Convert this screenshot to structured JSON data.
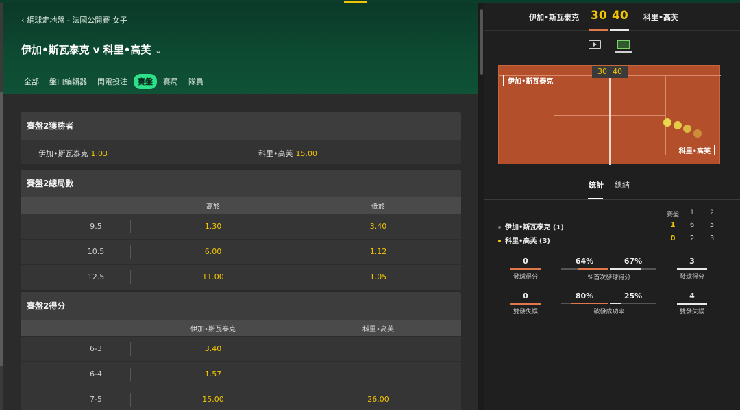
{
  "header": {
    "breadcrumb": "網球走地盤 - 法國公開賽 女子",
    "title": "伊加•斯瓦泰克 v 科里•高芙",
    "tabs": [
      "全部",
      "盤口編輯器",
      "閃電投注",
      "賽盤",
      "賽局",
      "隊員"
    ],
    "active_tab": "賽盤"
  },
  "markets": {
    "winner": {
      "title": "賽盤2獲勝者",
      "p1": "伊加•斯瓦泰克",
      "p1_odds": "1.03",
      "p2": "科里•高芙",
      "p2_odds": "15.00"
    },
    "total_games": {
      "title": "賽盤2總局數",
      "col_over": "高於",
      "col_under": "低於",
      "rows": [
        {
          "line": "9.5",
          "over": "1.30",
          "under": "3.40"
        },
        {
          "line": "10.5",
          "over": "6.00",
          "under": "1.12"
        },
        {
          "line": "12.5",
          "over": "11.00",
          "under": "1.05"
        }
      ]
    },
    "correct_score": {
      "title": "賽盤2得分",
      "col_p1": "伊加•斯瓦泰克",
      "col_p2": "科里•高芙",
      "rows": [
        {
          "score": "6-3",
          "p1": "3.40",
          "p2": ""
        },
        {
          "score": "6-4",
          "p1": "1.57",
          "p2": ""
        },
        {
          "score": "7-5",
          "p1": "15.00",
          "p2": "26.00"
        }
      ]
    }
  },
  "scoreboard": {
    "p1": "伊加•斯瓦泰克",
    "p1_points": "30",
    "p2": "科里•高芙",
    "p2_points": "40",
    "court_p1": "伊加•斯瓦泰克",
    "court_p2": "科里•高芙",
    "icons": [
      "video-icon",
      "court-icon"
    ]
  },
  "stats": {
    "tabs": [
      "統計",
      "總結"
    ],
    "sets_label": "賽盤",
    "set_numbers": [
      "1",
      "2"
    ],
    "p1": {
      "name": "伊加•斯瓦泰克 (1)",
      "current": "1",
      "sets": [
        "6",
        "5"
      ]
    },
    "p2": {
      "name": "科里•高芙 (3)",
      "current": "0",
      "sets": [
        "2",
        "3"
      ]
    },
    "aces": {
      "p1": "0",
      "p2": "3",
      "label": "發球得分"
    },
    "first_serve": {
      "p1": "64%",
      "p2": "67%",
      "p1_value": 0.64,
      "p2_value": 0.67,
      "label": "%首次發球得分"
    },
    "double_faults": {
      "p1": "0",
      "p2": "4",
      "label": "雙發失誤"
    },
    "break_points": {
      "p1": "80%",
      "p2": "25%",
      "p1_value": 0.8,
      "p2_value": 0.25,
      "label": "破發成功率"
    }
  },
  "colors": {
    "odds": "#f2c500",
    "p1": "#e0784a",
    "p2": "#e8e8e8",
    "active_tab": "#2fe08a",
    "court": "#b34f2a"
  }
}
